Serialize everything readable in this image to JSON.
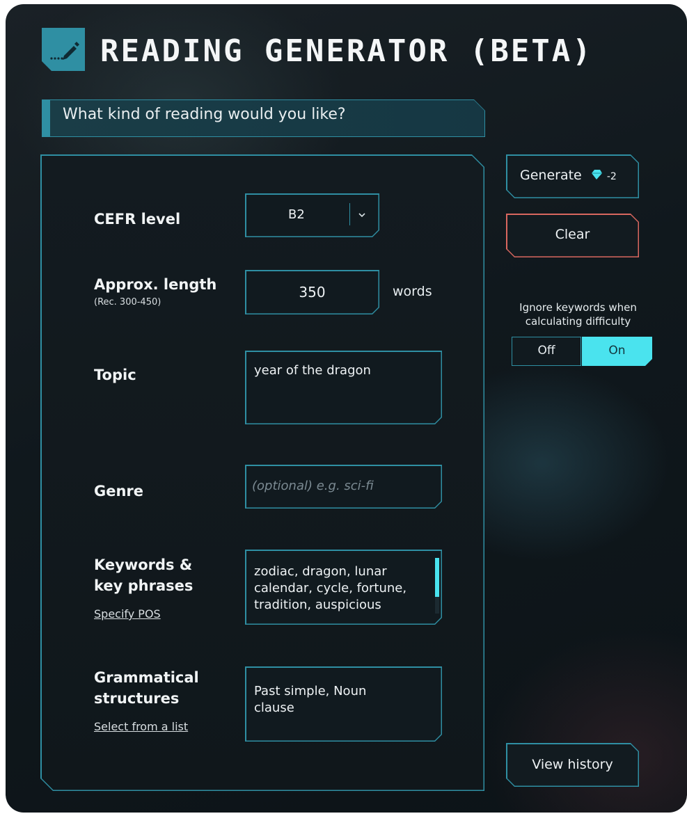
{
  "header": {
    "title": "READING GENERATOR (BETA)",
    "icon": "edit-pencil-icon"
  },
  "prompt": "What kind of reading would you like?",
  "form": {
    "cefr": {
      "label": "CEFR level",
      "value": "B2"
    },
    "length": {
      "label": "Approx. length",
      "hint": "(Rec. 300-450)",
      "value": "350",
      "unit": "words"
    },
    "topic": {
      "label": "Topic",
      "value": "year of the dragon"
    },
    "genre": {
      "label": "Genre",
      "placeholder": "(optional) e.g. sci-fi"
    },
    "keywords": {
      "label_line1": "Keywords &",
      "label_line2": "key phrases",
      "link": "Specify POS",
      "value": "zodiac, dragon, lunar calendar, cycle, fortune, tradition, auspicious"
    },
    "grammar": {
      "label_line1": "Grammatical",
      "label_line2": "structures",
      "link": "Select from a list",
      "value": "Past simple, Noun clause"
    }
  },
  "actions": {
    "generate_label": "Generate",
    "generate_cost": "-2",
    "gem_icon": "gem-icon",
    "clear_label": "Clear",
    "ignore_caption": "Ignore keywords when calculating difficulty",
    "toggle_off": "Off",
    "toggle_on": "On",
    "toggle_state": "On",
    "history_label": "View history"
  },
  "colors": {
    "accent": "#2f8fa3",
    "toggle_active": "#4ae3ee",
    "clear_border": "#d9675f",
    "background": "#10181d"
  }
}
